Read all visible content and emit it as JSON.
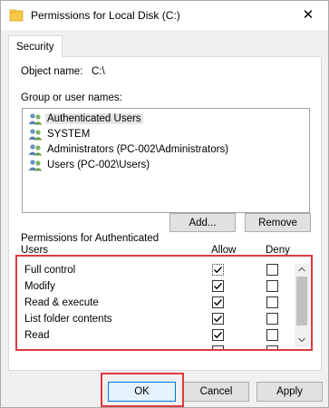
{
  "window": {
    "title": "Permissions for Local Disk (C:)",
    "close_glyph": "✕"
  },
  "tab": {
    "label": "Security"
  },
  "object": {
    "label": "Object name:",
    "value": "C:\\"
  },
  "groups": {
    "label": "Group or user names:",
    "items": [
      {
        "label": "Authenticated Users",
        "selected": true
      },
      {
        "label": "SYSTEM",
        "selected": false
      },
      {
        "label": "Administrators (PC-002\\Administrators)",
        "selected": false
      },
      {
        "label": "Users (PC-002\\Users)",
        "selected": false
      }
    ]
  },
  "buttons": {
    "add": "Add...",
    "remove": "Remove",
    "ok": "OK",
    "cancel": "Cancel",
    "apply": "Apply"
  },
  "permissions": {
    "label_line1": "Permissions for Authenticated",
    "label_line2": "Users",
    "allow_header": "Allow",
    "deny_header": "Deny",
    "rows": [
      {
        "name": "Full control",
        "allow": true,
        "deny": false
      },
      {
        "name": "Modify",
        "allow": true,
        "deny": false
      },
      {
        "name": "Read & execute",
        "allow": true,
        "deny": false
      },
      {
        "name": "List folder contents",
        "allow": true,
        "deny": false
      },
      {
        "name": "Read",
        "allow": true,
        "deny": false
      }
    ]
  },
  "colors": {
    "highlight_border": "#e0393e",
    "accent": "#0078d7",
    "icon_yellow": "#f7c948"
  },
  "icons": {
    "title": "folder-icon",
    "user": "user-group-icon"
  }
}
